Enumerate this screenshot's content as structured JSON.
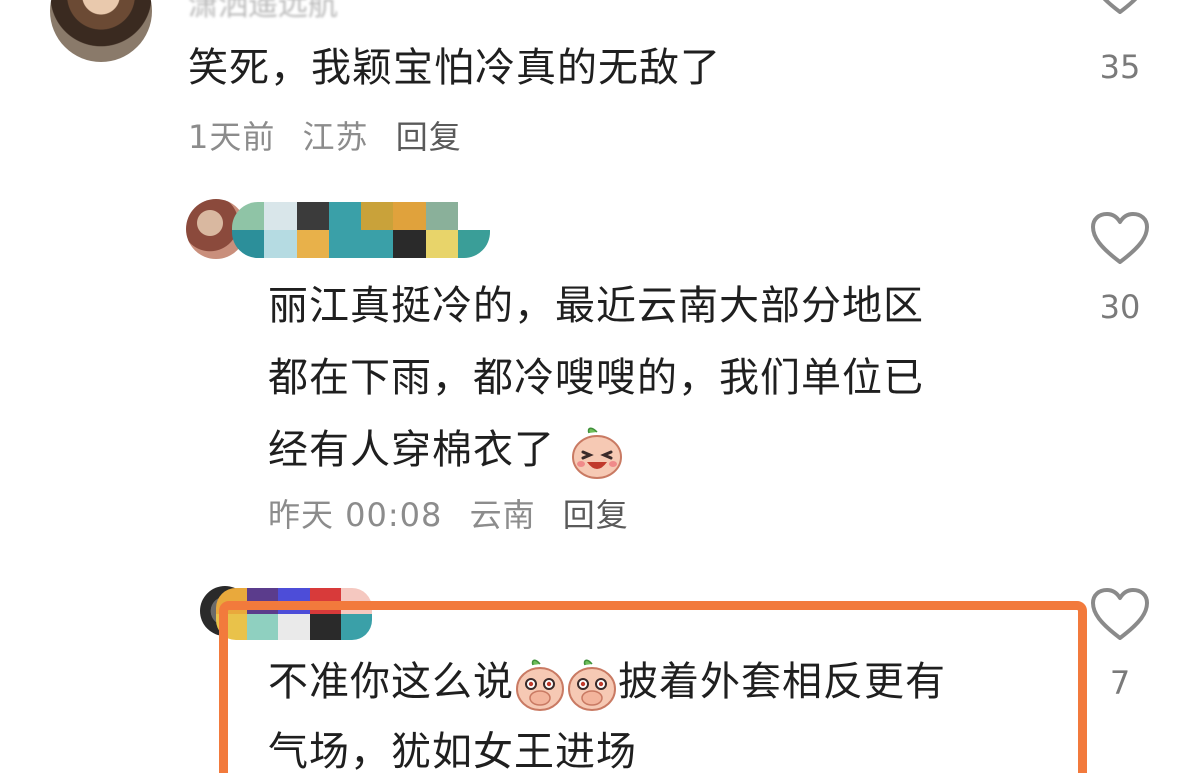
{
  "comments": [
    {
      "author": "潇​洒遥远航",
      "text": "笑死，我颖宝怕冷真的无敌了",
      "time": "1天前",
      "location": "江苏",
      "reply_label": "回复",
      "likes": "35"
    },
    {
      "author": "",
      "text_line1": "丽江真挺冷的，最近云南大部分地区",
      "text_line2": "都在下雨，都冷嗖嗖的，我们单位已",
      "text_line3": "经有人穿棉衣了",
      "emoji": "laughing-face-emoji",
      "time": "昨天 00:08",
      "location": "云南",
      "reply_label": "回复",
      "likes": "30"
    },
    {
      "author": "",
      "text_part1": "不准你这么说",
      "text_part2": "披着外套相反更有",
      "text_line2": "气场，犹如女王进场",
      "emoji": "covering-mouth-emoji",
      "likes": "7"
    }
  ],
  "colors": {
    "highlight_border": "#f27a3c",
    "text": "#1f1f1f",
    "meta": "#8c8c8c"
  }
}
